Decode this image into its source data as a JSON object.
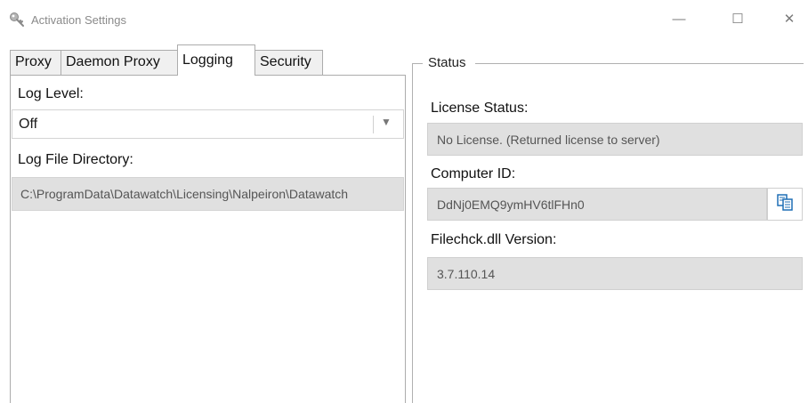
{
  "window": {
    "title": "Activation Settings",
    "icon": "key-icon",
    "controls": {
      "minimize": "—",
      "maximize": "☐",
      "close": "✕"
    }
  },
  "tabs": [
    {
      "label": "Proxy",
      "active": false
    },
    {
      "label": "Daemon Proxy",
      "active": false
    },
    {
      "label": "Logging",
      "active": true
    },
    {
      "label": "Security",
      "active": false
    }
  ],
  "logging": {
    "log_level_label": "Log Level:",
    "log_level_value": "Off",
    "log_dir_label": "Log File Directory:",
    "log_dir_value": "C:\\ProgramData\\Datawatch\\Licensing\\Nalpeiron\\Datawatch"
  },
  "status": {
    "legend": "Status",
    "license_status_label": "License Status:",
    "license_status_value": "No License. (Returned license to server)",
    "computer_id_label": "Computer ID:",
    "computer_id_value": "DdNj0EMQ9ymHV6tlFHn0",
    "copy_icon": "copy-icon",
    "filechk_label": "Filechck.dll Version:",
    "filechk_value": "3.7.110.14"
  }
}
